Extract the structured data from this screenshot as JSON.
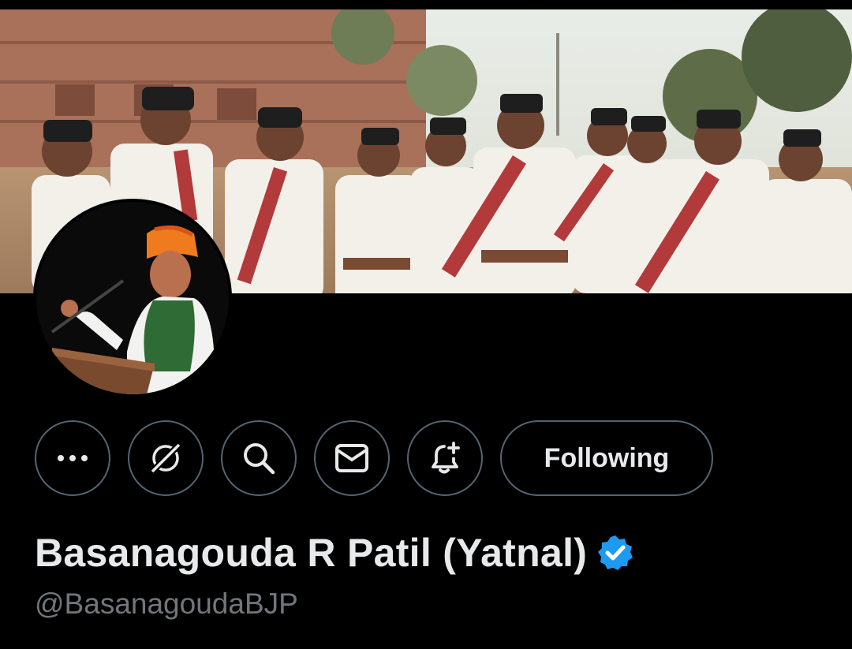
{
  "profile": {
    "display_name": "Basanagouda R Patil (Yatnal)",
    "handle": "@BasanagoudaBJP",
    "verified": true
  },
  "actions": {
    "more_icon": "more-dots-icon",
    "grok_icon": "grok-icon",
    "search_icon": "search-icon",
    "message_icon": "envelope-icon",
    "notify_icon": "bell-plus-icon",
    "follow_label": "Following"
  },
  "colors": {
    "background": "#000000",
    "text_primary": "#e7e9ea",
    "text_secondary": "#71767b",
    "border": "#536471",
    "verified_blue": "#1d9bf0"
  }
}
